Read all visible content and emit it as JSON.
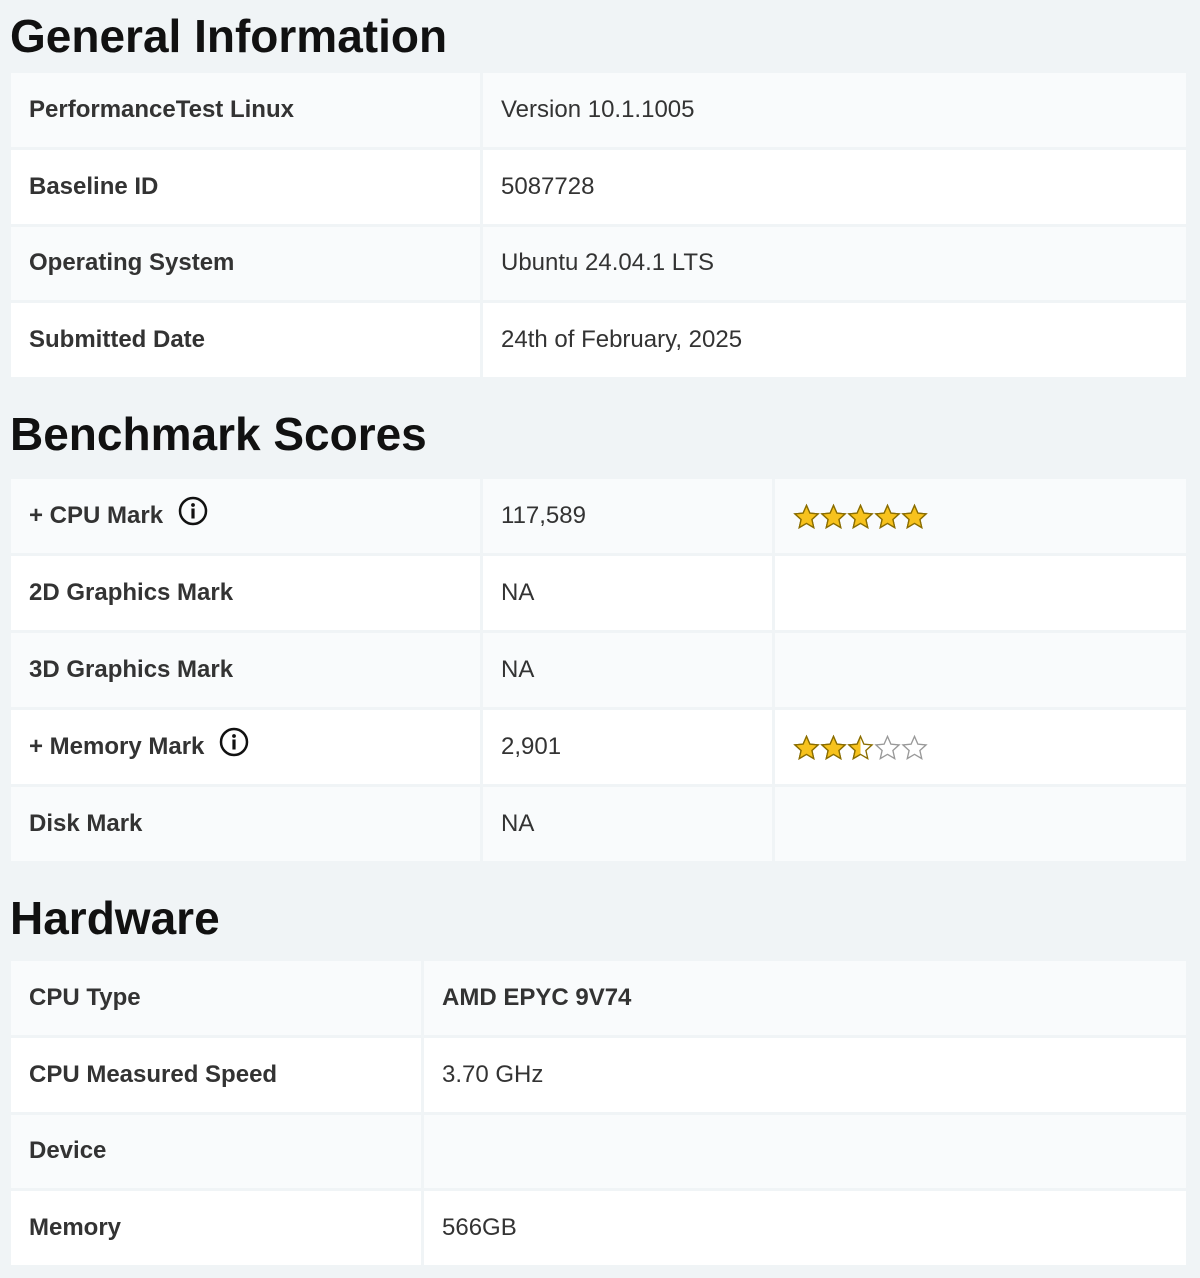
{
  "general": {
    "title": "General Information",
    "rows": [
      {
        "label": "PerformanceTest Linux",
        "value": "Version 10.1.1005"
      },
      {
        "label": "Baseline ID",
        "value": "5087728"
      },
      {
        "label": "Operating System",
        "value": "Ubuntu 24.04.1 LTS"
      },
      {
        "label": "Submitted Date",
        "value": "24th of February, 2025"
      }
    ]
  },
  "benchmark": {
    "title": "Benchmark Scores",
    "rows": [
      {
        "label": "+ CPU Mark",
        "value": "117,589",
        "stars": 5
      },
      {
        "label": "2D Graphics Mark",
        "value": "NA"
      },
      {
        "label": "3D Graphics Mark",
        "value": "NA"
      },
      {
        "label": "+ Memory Mark",
        "value": "2,901",
        "stars": 2.5
      },
      {
        "label": "Disk Mark",
        "value": "NA"
      }
    ]
  },
  "hardware": {
    "title": "Hardware",
    "rows": [
      {
        "label": "CPU Type",
        "value": "AMD EPYC 9V74"
      },
      {
        "label": "CPU Measured Speed",
        "value": "3.70 GHz"
      },
      {
        "label": "Device",
        "value": ""
      },
      {
        "label": "Memory",
        "value": "566GB"
      }
    ]
  },
  "icons": {
    "info": "info-circle-icon",
    "star": "star-icon"
  },
  "colors": {
    "link": "#3d6e73",
    "star_fill": "#f7c21d",
    "star_stroke": "#8a6d00",
    "background": "#f0f4f6"
  }
}
